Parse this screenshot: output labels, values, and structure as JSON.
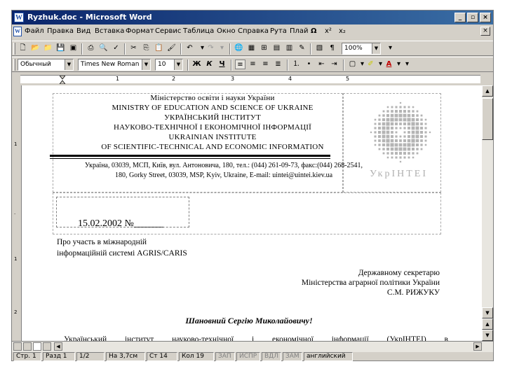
{
  "window": {
    "title": "Ryzhuk.doc - Microsoft Word",
    "buttons": [
      "_",
      "▫",
      "×"
    ]
  },
  "menu": {
    "items": [
      "Файл",
      "Правка",
      "Вид",
      "Вставка",
      "Формат",
      "Сервис",
      "Таблица",
      "Окно",
      "Справка",
      "Рута",
      "Плай"
    ],
    "symbols": [
      "Ω",
      "x²",
      "x₂"
    ]
  },
  "toolbar_standard": {
    "zoom": "100%"
  },
  "toolbar_format": {
    "style": "Обычный",
    "font": "Times New Roman",
    "size": "10"
  },
  "ruler": {
    "numbers": [
      "1",
      "2",
      "3",
      "4",
      "5"
    ]
  },
  "letterhead": {
    "ministry_ua": "Міністерство освіти і науки України",
    "ministry_en": "MINISTRY OF EDUCATION AND SCIENCE OF UKRAINE",
    "institute_ua": "УКРАЇНСЬКИЙ ІНСТИТУТ",
    "institute_ua_2": "НАУКОВО-ТЕХНІЧНОЇ І ЕКОНОМІЧНОЇ ІНФОРМАЦІЇ",
    "institute_en_1": "UKRAINIAN INSTITUTE",
    "institute_en_2": "OF SCIENTIFIC-TECHNICAL AND ECONOMIC INFORMATION",
    "address_ua": "Україна, 03039, МСП, Київ, вул. Антоновича, 180, тел.: (044) 261-09-73, факс:(044) 268-2541,",
    "address_en": "180, Gorky Street, 03039, MSP, Kyiv, Ukraine, E-mail: uintei@uintei.kiev.ua",
    "logo_text": "УкрІНТЕІ"
  },
  "letter": {
    "date": "15.02.2002 №______",
    "subject_1": "Про участь в міжнародній",
    "subject_2": "інформаційній системі AGRIS/CARIS",
    "recipient_1": "Державному секретарю",
    "recipient_2": "Міністерства аграрної політики України",
    "recipient_3": "С.М. РИЖУКУ",
    "greeting": "Шановний Сергію Миколайовичу!",
    "body_words": [
      "Український",
      "інститут",
      "науково-технічної",
      "і",
      "економічної",
      "інформації",
      "(УкрІНТЕІ)",
      "в"
    ]
  },
  "status": {
    "page": "Стр. 1",
    "section": "Разд 1",
    "pages": "1/2",
    "at": "На 3,7см",
    "line": "Ст 14",
    "col": "Кол 19",
    "rec": "ЗАП",
    "trk": "ИСПР",
    "ext": "ВДЛ",
    "ovr": "ЗАМ",
    "lang": "английский"
  }
}
